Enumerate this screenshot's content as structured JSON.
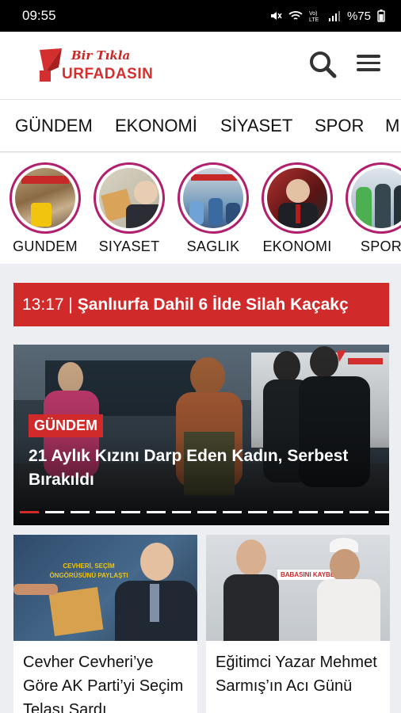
{
  "status_bar": {
    "time": "09:55",
    "battery": "%75"
  },
  "app": {
    "logo_tagline": "Bir Tıkla",
    "logo_brand": "URFADASIN"
  },
  "nav": {
    "categories": [
      "GÜNDEM",
      "EKONOMİ",
      "SİYASET",
      "SPOR",
      "M"
    ]
  },
  "stories": [
    {
      "label": "GUNDEM"
    },
    {
      "label": "SIYASET"
    },
    {
      "label": "SAGLIK"
    },
    {
      "label": "EKONOMI"
    },
    {
      "label": "SPOR"
    }
  ],
  "ticker": {
    "time": "13:17 |",
    "title": "Şanlıurfa Dahil 6 İlde Silah Kaçakç"
  },
  "hero": {
    "category": "GÜNDEM",
    "headline": "21 Aylık Kızını Darp Eden Kadın, Serbest Bırakıldı",
    "slide_count": 15,
    "active_slide": 1
  },
  "cards": [
    {
      "title": "Cevher Cevheri’ye Göre AK Parti’yi Seçim Telaşı Sardı",
      "image_caption": "CEVHERİ, SEÇİM ÖNGÖRÜSÜNÜ PAYLAŞTI"
    },
    {
      "title": "Eğitimci Yazar Mehmet Sarmış’ın Acı Günü",
      "image_caption": "BABASINI KAYBETTİ"
    }
  ],
  "colors": {
    "brand_red": "#d12a2a",
    "story_ring": "#b0206d"
  }
}
